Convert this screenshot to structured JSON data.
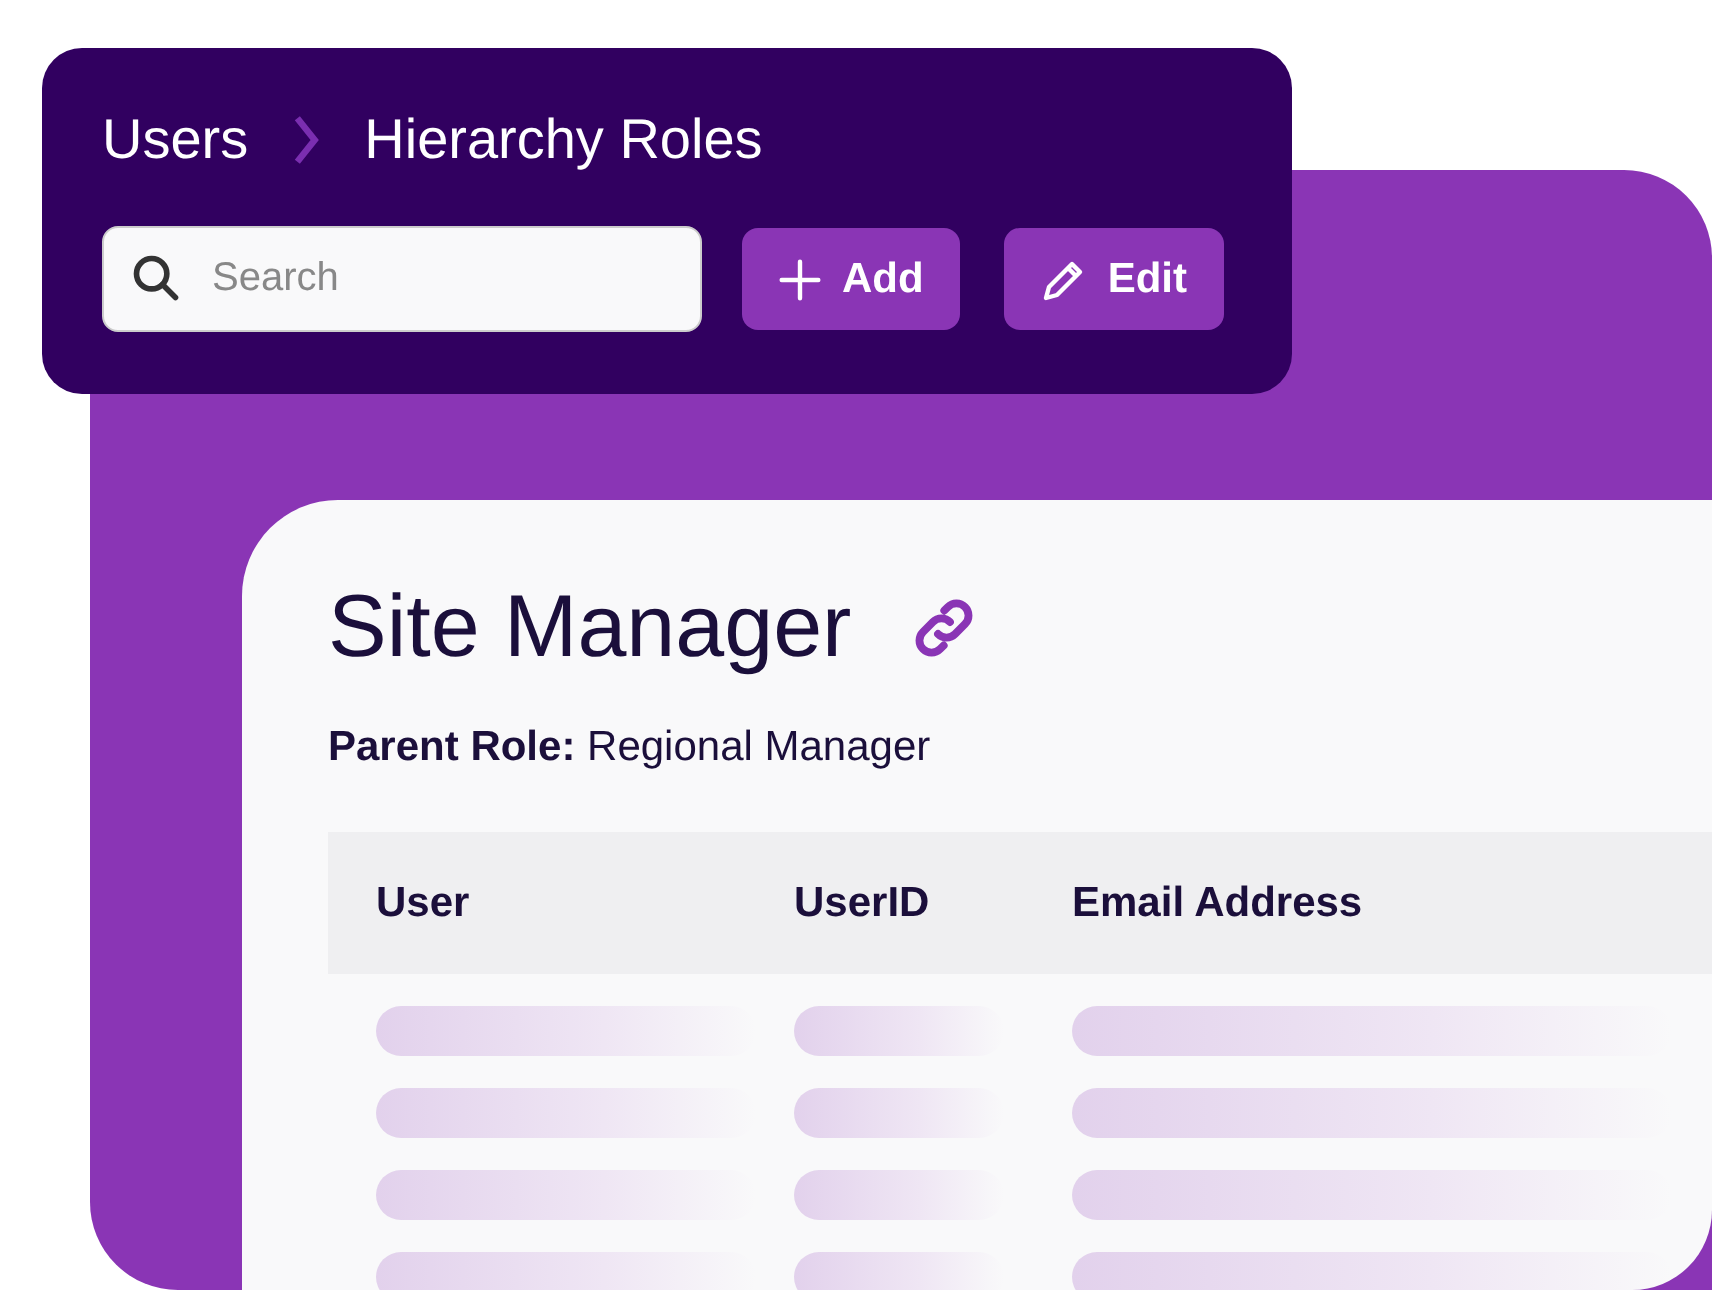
{
  "toolbar": {
    "breadcrumb": [
      "Users",
      "Hierarchy Roles"
    ],
    "search": {
      "placeholder": "Search"
    },
    "buttons": [
      {
        "label": "Add",
        "kind": "add"
      },
      {
        "label": "Edit",
        "kind": "edit"
      }
    ]
  },
  "role": {
    "title": "Site Manager",
    "parent_role": "**Parent Role:** Regional Manager"
  },
  "table": {
    "columns": [
      "User",
      "UserID",
      "Email Address"
    ]
  }
}
